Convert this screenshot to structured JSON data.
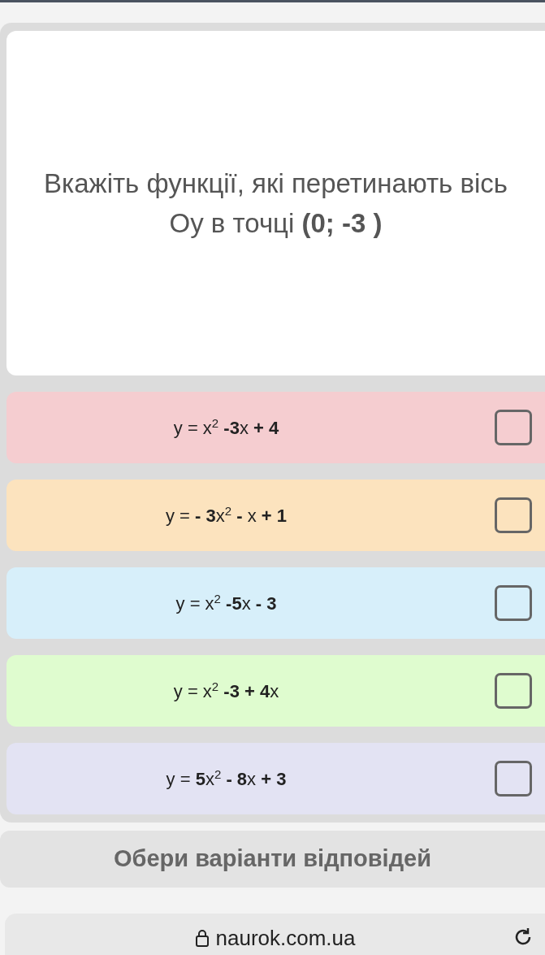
{
  "question": "Вкажіть функції, які перетинають вісь Оу в точці **(0; -3 )**",
  "options": [
    {
      "formula": "y = x$^{2}$ **-3**x **+ 4**",
      "color": "#f5cdd0",
      "checked": false
    },
    {
      "formula": "y = **- 3**x$^{2}$ **-** x **+ 1**",
      "color": "#fce3be",
      "checked": false
    },
    {
      "formula": "y = x$^{2}$ **-5**x **- 3**",
      "color": "#d7effa",
      "checked": false
    },
    {
      "formula": "y = x$^{2}$ **-3 + 4**x",
      "color": "#dffccf",
      "checked": false
    },
    {
      "formula": "y = **5**x$^{2}$ **- 8**x **+ 3**",
      "color": "#e3e3f3",
      "checked": false
    }
  ],
  "submit_label": "Обери варіанти відповідей",
  "address": "naurok.com.ua"
}
